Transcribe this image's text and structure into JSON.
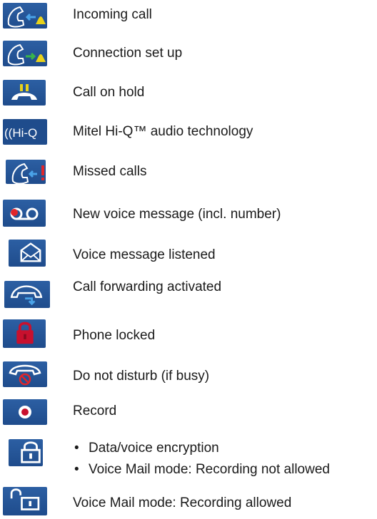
{
  "items": [
    {
      "label": "Incoming call",
      "icon": "incoming-call-icon"
    },
    {
      "label": "Connection set up",
      "icon": "connection-setup-icon"
    },
    {
      "label": "Call on hold",
      "icon": "call-on-hold-icon"
    },
    {
      "label": "Mitel Hi-Q™ audio technology",
      "icon": "hi-q-icon",
      "icon_text": "((Hi-Q"
    },
    {
      "label": "Missed calls",
      "icon": "missed-calls-icon"
    },
    {
      "label": "New voice message (incl. number)",
      "icon": "voice-message-icon"
    },
    {
      "label": "Voice message listened",
      "icon": "envelope-icon"
    },
    {
      "label": "Call forwarding activated",
      "icon": "call-forwarding-icon"
    },
    {
      "label": "Phone locked",
      "icon": "padlock-icon"
    },
    {
      "label": "Do not disturb (if busy)",
      "icon": "do-not-disturb-icon"
    },
    {
      "label": "Record",
      "icon": "record-icon"
    },
    {
      "bullets": [
        "Data/voice encryption",
        "Voice Mail mode: Recording not allowed"
      ],
      "icon": "lock-icon"
    },
    {
      "label": "Voice Mail mode: Recording allowed",
      "icon": "unlocked-icon"
    }
  ],
  "colors": {
    "icon_bg": "#2c5fa3",
    "icon_fg": "#ffffff",
    "arrow_blue": "#4aa3e8",
    "arrow_green": "#39b54a",
    "bell_yellow": "#e8d21a",
    "alert_red": "#e0262b",
    "lock_red": "#c8102e"
  }
}
